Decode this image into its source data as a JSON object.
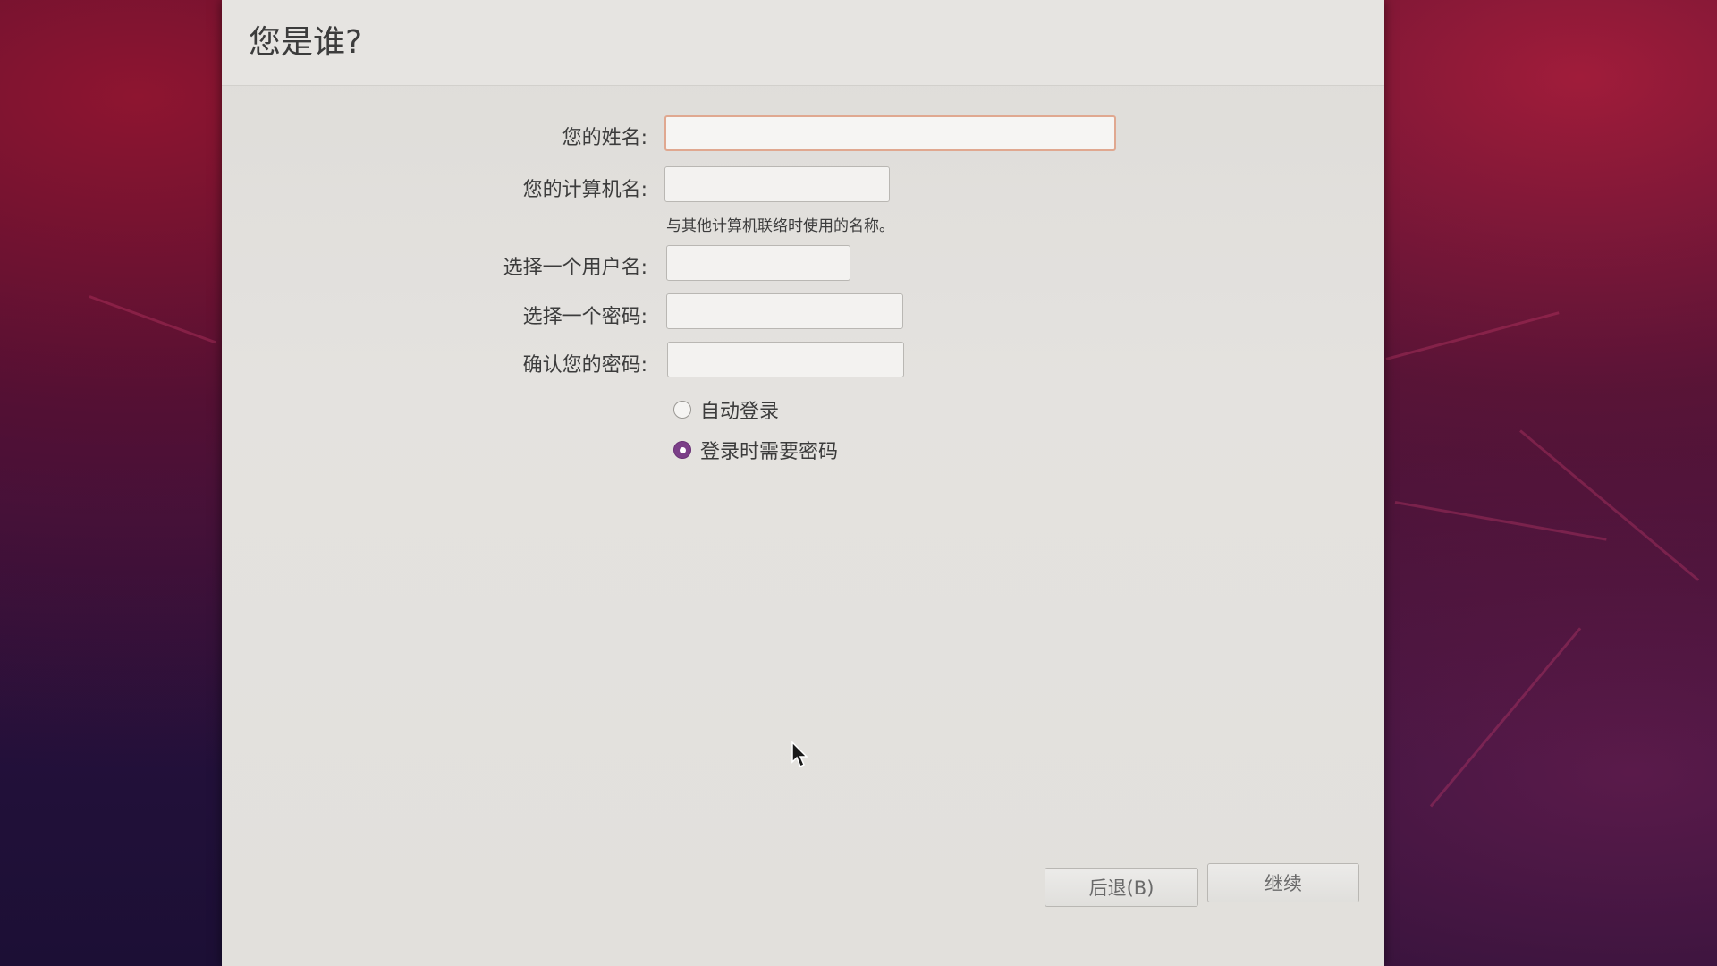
{
  "page": {
    "title": "您是谁?"
  },
  "form": {
    "name_label": "您的姓名:",
    "name_value": "",
    "computer_label": "您的计算机名:",
    "computer_value": "",
    "computer_hint": "与其他计算机联络时使用的名称。",
    "username_label": "选择一个用户名:",
    "username_value": "",
    "password_label": "选择一个密码:",
    "password_value": "",
    "confirm_label": "确认您的密码:",
    "confirm_value": ""
  },
  "login_options": [
    {
      "label": "自动登录",
      "selected": false
    },
    {
      "label": "登录时需要密码",
      "selected": true
    }
  ],
  "buttons": {
    "back_label": "后退(B)",
    "continue_label": "继续"
  },
  "colors": {
    "radio_selected": "#7b3f88",
    "focus_border": "#e0a890"
  }
}
